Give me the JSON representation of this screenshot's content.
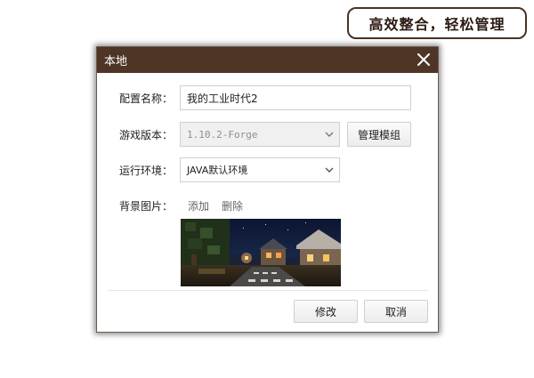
{
  "promo": {
    "text": "高效整合，轻松管理"
  },
  "dialog": {
    "title": "本地",
    "fields": {
      "config_name": {
        "label": "配置名称：",
        "value": "我的工业时代2"
      },
      "game_version": {
        "label": "游戏版本：",
        "value": "1.10.2-Forge"
      },
      "runtime_env": {
        "label": "运行环境：",
        "value": "JAVA默认环境"
      },
      "background": {
        "label": "背景图片：",
        "add_label": "添加",
        "delete_label": "删除"
      }
    },
    "manage_mods_label": "管理模组",
    "buttons": {
      "modify": "修改",
      "cancel": "取消"
    }
  },
  "colors": {
    "titlebar": "#4e3526",
    "promo_border": "#4a3325"
  },
  "icons": {
    "close": "close-icon",
    "dropdown": "chevron-down-icon"
  }
}
